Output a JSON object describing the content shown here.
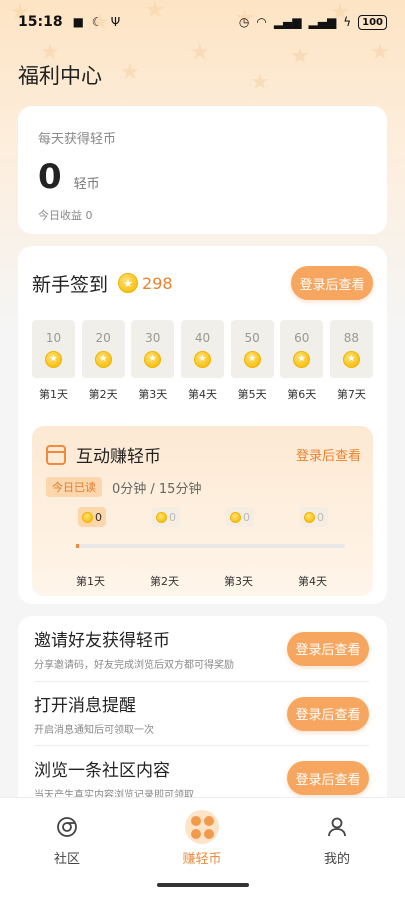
{
  "status_bar": {
    "time": "15:18",
    "battery": "100"
  },
  "page": {
    "title": "福利中心"
  },
  "balance": {
    "caption": "每天获得轻币",
    "value": "0",
    "unit": "轻币",
    "today": "今日收益 0"
  },
  "checkin": {
    "title": "新手签到",
    "total": "298",
    "login_label": "登录后查看",
    "days": [
      {
        "value": "10",
        "label": "第1天"
      },
      {
        "value": "20",
        "label": "第2天"
      },
      {
        "value": "30",
        "label": "第3天"
      },
      {
        "value": "40",
        "label": "第4天"
      },
      {
        "value": "50",
        "label": "第5天"
      },
      {
        "value": "60",
        "label": "第6天"
      },
      {
        "value": "88",
        "label": "第7天"
      }
    ]
  },
  "interact": {
    "title": "互动赚轻币",
    "login_label": "登录后查看",
    "read_tag": "今日已读",
    "read_time": "0分钟 / 15分钟",
    "progress_fraction": 0,
    "milestones": [
      {
        "value": "0",
        "label": "第1天",
        "active": true
      },
      {
        "value": "0",
        "label": "第2天",
        "active": false
      },
      {
        "value": "0",
        "label": "第3天",
        "active": false
      },
      {
        "value": "0",
        "label": "第4天",
        "active": false
      }
    ]
  },
  "tasks": [
    {
      "title": "邀请好友获得轻币",
      "desc": "分享邀请码，好友完成浏览后双方都可得奖励",
      "button": "登录后查看"
    },
    {
      "title": "打开消息提醒",
      "desc": "开启消息通知后可领取一次",
      "button": "登录后查看"
    },
    {
      "title": "浏览一条社区内容",
      "desc": "当天产生真实内容浏览记录即可领取",
      "button": "登录后查看"
    }
  ],
  "tabbar": {
    "community": "社区",
    "earn": "赚轻币",
    "mine": "我的",
    "active": "earn"
  },
  "colors": {
    "accent": "#f7a65f",
    "accent_text": "#e9822f",
    "coin": "#f7c21a"
  }
}
